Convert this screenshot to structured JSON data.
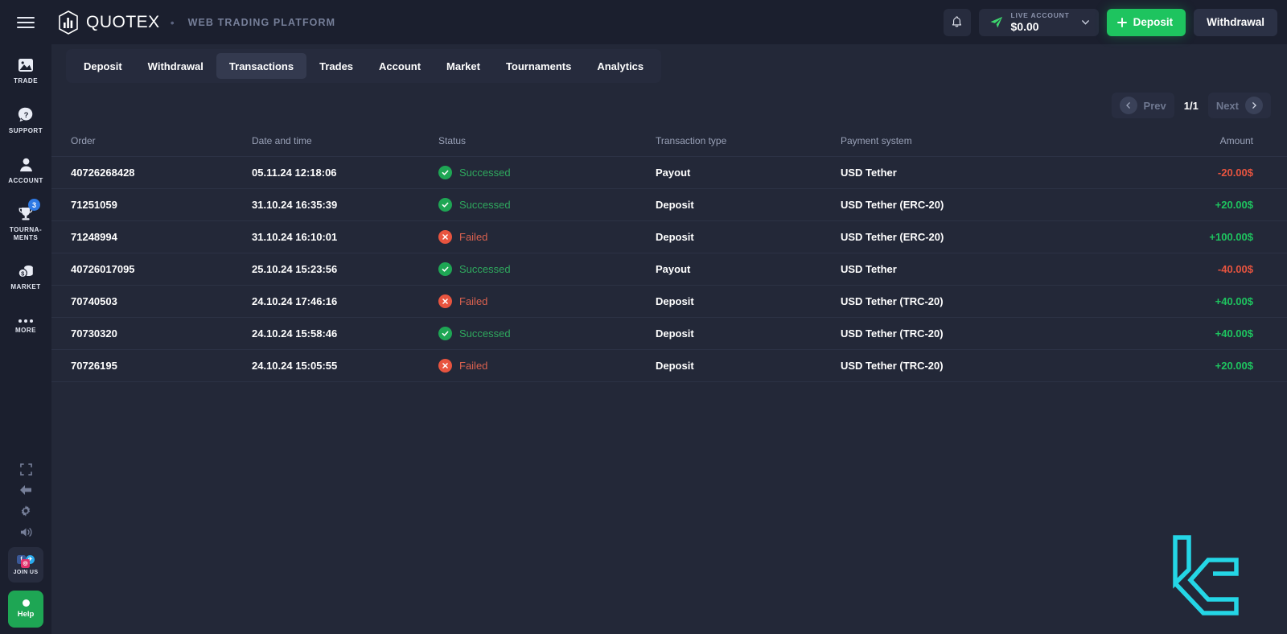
{
  "brand": {
    "name": "QUOTEX",
    "separator": "•",
    "subtitle": "WEB TRADING PLATFORM",
    "logo_icon": "quotex-hex-logo"
  },
  "topbar": {
    "notifications_icon": "bell-icon",
    "account": {
      "plane_icon": "paper-plane-icon",
      "label": "LIVE ACCOUNT",
      "balance": "$0.00",
      "chevron_icon": "chevron-down-icon"
    },
    "deposit_label": "Deposit",
    "deposit_plus_icon": "plus-icon",
    "withdrawal_label": "Withdrawal",
    "menu_icon": "hamburger-menu-icon"
  },
  "sidebar": {
    "items": [
      {
        "label": "Trade",
        "icon": "chart-picture-icon",
        "badge": null
      },
      {
        "label": "Support",
        "icon": "question-chat-icon",
        "badge": null
      },
      {
        "label": "Account",
        "icon": "user-person-icon",
        "badge": null
      },
      {
        "label": "Tourna-\nments",
        "icon": "trophy-icon",
        "badge": "3"
      },
      {
        "label": "Market",
        "icon": "coins-dollar-icon",
        "badge": null
      },
      {
        "label": "More",
        "icon": "ellipsis-icon",
        "badge": null
      }
    ],
    "bottom_icons": [
      "fullscreen-icon",
      "collapse-arrow-icon",
      "gear-settings-icon",
      "sound-volume-icon"
    ],
    "join_us": {
      "label": "JOIN US",
      "networks": [
        "facebook-icon",
        "telegram-icon",
        "instagram-icon"
      ]
    },
    "help": {
      "label": "Help",
      "icon": "help-dot-icon"
    }
  },
  "tabs": [
    {
      "label": "Deposit",
      "active": false
    },
    {
      "label": "Withdrawal",
      "active": false
    },
    {
      "label": "Transactions",
      "active": true
    },
    {
      "label": "Trades",
      "active": false
    },
    {
      "label": "Account",
      "active": false
    },
    {
      "label": "Market",
      "active": false
    },
    {
      "label": "Tournaments",
      "active": false
    },
    {
      "label": "Analytics",
      "active": false
    }
  ],
  "pagination": {
    "prev_label": "Prev",
    "next_label": "Next",
    "page_indicator": "1/1",
    "prev_icon": "chevron-left-icon",
    "next_icon": "chevron-right-icon"
  },
  "table": {
    "columns": [
      "Order",
      "Date and time",
      "Status",
      "Transaction type",
      "Payment system",
      "Amount"
    ],
    "rows": [
      {
        "order": "40726268428",
        "datetime": "05.11.24 12:18:06",
        "status": "Successed",
        "status_state": "ok",
        "type": "Payout",
        "payment_system": "USD Tether",
        "amount": "-20.00$",
        "amount_sign": "neg"
      },
      {
        "order": "71251059",
        "datetime": "31.10.24 16:35:39",
        "status": "Successed",
        "status_state": "ok",
        "type": "Deposit",
        "payment_system": "USD Tether (ERC-20)",
        "amount": "+20.00$",
        "amount_sign": "pos"
      },
      {
        "order": "71248994",
        "datetime": "31.10.24 16:10:01",
        "status": "Failed",
        "status_state": "fail",
        "type": "Deposit",
        "payment_system": "USD Tether (ERC-20)",
        "amount": "+100.00$",
        "amount_sign": "pos"
      },
      {
        "order": "40726017095",
        "datetime": "25.10.24 15:23:56",
        "status": "Successed",
        "status_state": "ok",
        "type": "Payout",
        "payment_system": "USD Tether",
        "amount": "-40.00$",
        "amount_sign": "neg"
      },
      {
        "order": "70740503",
        "datetime": "24.10.24 17:46:16",
        "status": "Failed",
        "status_state": "fail",
        "type": "Deposit",
        "payment_system": "USD Tether (TRC-20)",
        "amount": "+40.00$",
        "amount_sign": "pos"
      },
      {
        "order": "70730320",
        "datetime": "24.10.24 15:58:46",
        "status": "Successed",
        "status_state": "ok",
        "type": "Deposit",
        "payment_system": "USD Tether (TRC-20)",
        "amount": "+40.00$",
        "amount_sign": "pos"
      },
      {
        "order": "70726195",
        "datetime": "24.10.24 15:05:55",
        "status": "Failed",
        "status_state": "fail",
        "type": "Deposit",
        "payment_system": "USD Tether (TRC-20)",
        "amount": "+20.00$",
        "amount_sign": "pos"
      }
    ]
  },
  "watermark": {
    "icon": "lc-cyan-logo-watermark"
  },
  "colors": {
    "page_bg": "#1b1f2e",
    "panel_bg": "#232838",
    "accent_green": "#1ec45f",
    "accent_red": "#e8543f",
    "badge_blue": "#2f7ae5",
    "watermark_cyan": "#25e0f0"
  }
}
